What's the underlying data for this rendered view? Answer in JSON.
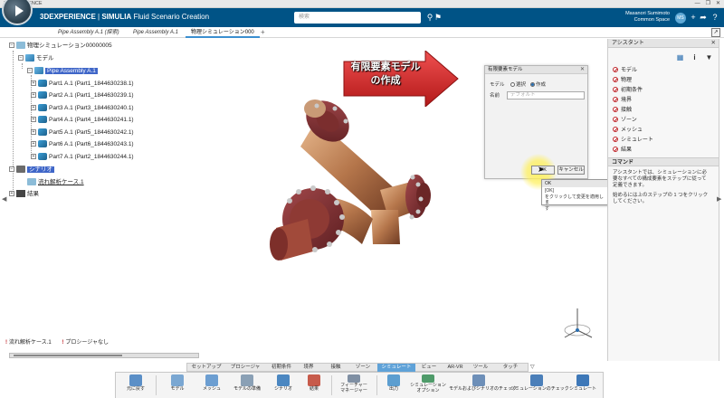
{
  "window": {
    "title": "3DEXPERIENCE",
    "controls": [
      "—",
      "❐",
      "✕"
    ]
  },
  "header": {
    "brand": "3DEXPERIENCE",
    "separator": " | ",
    "product": "SIMULIA",
    "app": " Fluid Scenario Creation",
    "search_placeholder": "検索",
    "user_name": "Masanori Sumimoto",
    "user_space": "Common Space",
    "avatar_initials": "MS"
  },
  "tabs": [
    {
      "label": "Pipe Assembly A.1 (探索)",
      "active": false
    },
    {
      "label": "Pipe Assembly A.1",
      "active": false
    },
    {
      "label": "物理シミュレーション000",
      "active": true
    }
  ],
  "tab_add": "+",
  "tree": {
    "root": "物理シミュレーション00000005",
    "model": "モデル",
    "assembly": "Pipe Assembly A.1",
    "parts": [
      "Part1 A.1 (Part1_1844630238.1)",
      "Part2 A.1 (Part1_1844630239.1)",
      "Part3 A.1 (Part3_1844630240.1)",
      "Part4 A.1 (Part4_1844630241.1)",
      "Part5 A.1 (Part5_1844630242.1)",
      "Part6 A.1 (Part6_1844630243.1)",
      "Part7 A.1 (Part2_1844630244.1)"
    ],
    "scenario": "シナリオ",
    "case": "流れ解析ケース.1",
    "results": "結果"
  },
  "annotation": {
    "line1": "有限要素モデル",
    "line2": "の作成"
  },
  "dialog": {
    "title": "有限要素モデル",
    "model_label": "モデル",
    "option_select": "選択",
    "option_create": "作成",
    "selected_option": "作成",
    "name_label": "名前",
    "name_placeholder": "デフォルト",
    "ok": "OK",
    "cancel": "キャンセル"
  },
  "tooltip": {
    "title": "OK",
    "line1": "[OK]",
    "line2": "をクリックして変更を適用しま",
    "line3": "す"
  },
  "assistant": {
    "title": "アシスタント",
    "steps": [
      "モデル",
      "物理",
      "初期条件",
      "境界",
      "接触",
      "ゾーン",
      "メッシュ",
      "シミュレート",
      "結果"
    ],
    "command_title": "コマンド",
    "text1_l1": "アシスタントでは、シミュレーションに必",
    "text1_l2": "要なすべての構成要素をステップに従って",
    "text1_l3": "定義できます。",
    "text2_l1": "始めるには上のステップの 1 つをクリック",
    "text2_l2": "してください。"
  },
  "status": {
    "case": "流れ解析ケース.1",
    "procedure": "プロシージャなし"
  },
  "action_tabs": [
    {
      "label": "セットアップ",
      "active": false
    },
    {
      "label": "プロシージャ",
      "active": false
    },
    {
      "label": "初期条件",
      "active": false
    },
    {
      "label": "境界",
      "active": false
    },
    {
      "label": "接触",
      "active": false
    },
    {
      "label": "ゾーン",
      "active": false
    },
    {
      "label": "シミュレート",
      "active": true
    },
    {
      "label": "ビュー",
      "active": false
    },
    {
      "label": "AR-VR",
      "active": false
    },
    {
      "label": "ツール",
      "active": false
    },
    {
      "label": "タッチ",
      "active": false
    }
  ],
  "action_buttons": [
    {
      "label1": "元に戻す",
      "label2": "",
      "color": "#5b8fc7"
    },
    {
      "label1": "モデル",
      "label2": "",
      "color": "#7aa7d2"
    },
    {
      "label1": "メッシュ",
      "label2": "",
      "color": "#6c9ed1"
    },
    {
      "label1": "モデルの準備",
      "label2": "",
      "color": "#8aa0b5"
    },
    {
      "label1": "シナリオ",
      "label2": "",
      "color": "#4b87c1"
    },
    {
      "label1": "結果",
      "label2": "",
      "color": "#c75b4b"
    },
    {
      "label1": "フィーチャー",
      "label2": "マネージャー",
      "color": "#7f8fa3"
    },
    {
      "label1": "出力",
      "label2": "",
      "color": "#5c9ed0"
    },
    {
      "label1": "シミュレーション",
      "label2": "オプション",
      "color": "#4f9b6a"
    },
    {
      "label1": "モデルおよびシナリオのチェック",
      "label2": "",
      "color": "#6d8fb8"
    },
    {
      "label1": "シミュレーションのチェック",
      "label2": "",
      "color": "#4b7fb9"
    },
    {
      "label1": "シミュレート",
      "label2": "",
      "color": "#3e78b8"
    }
  ],
  "colors": {
    "header": "#005386",
    "highlight": "#3f66c8",
    "pipe": "#8b3a2a",
    "arrow": "#d52b2b"
  }
}
